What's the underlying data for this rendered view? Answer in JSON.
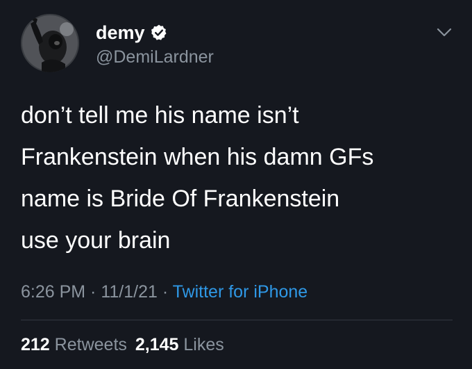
{
  "user": {
    "display_name": "demy",
    "handle": "@DemiLardner",
    "verified": true,
    "avatar_icon": "gorilla-avatar-icon"
  },
  "tweet": {
    "text": "don’t tell me his name isn’t\nFrankenstein when his damn GFs\nname is Bride Of Frankenstein\nuse your brain"
  },
  "meta": {
    "time": "6:26 PM",
    "sep1": " · ",
    "date": "11/1/21",
    "sep2": " · ",
    "source": "Twitter for iPhone"
  },
  "stats": {
    "retweets_count": "212",
    "retweets_label": "Retweets",
    "likes_count": "2,145",
    "likes_label": "Likes"
  },
  "colors": {
    "background": "#15181f",
    "primary_text": "#ffffff",
    "secondary_text": "#8b949e",
    "link": "#2f98e6",
    "divider": "#343841"
  }
}
